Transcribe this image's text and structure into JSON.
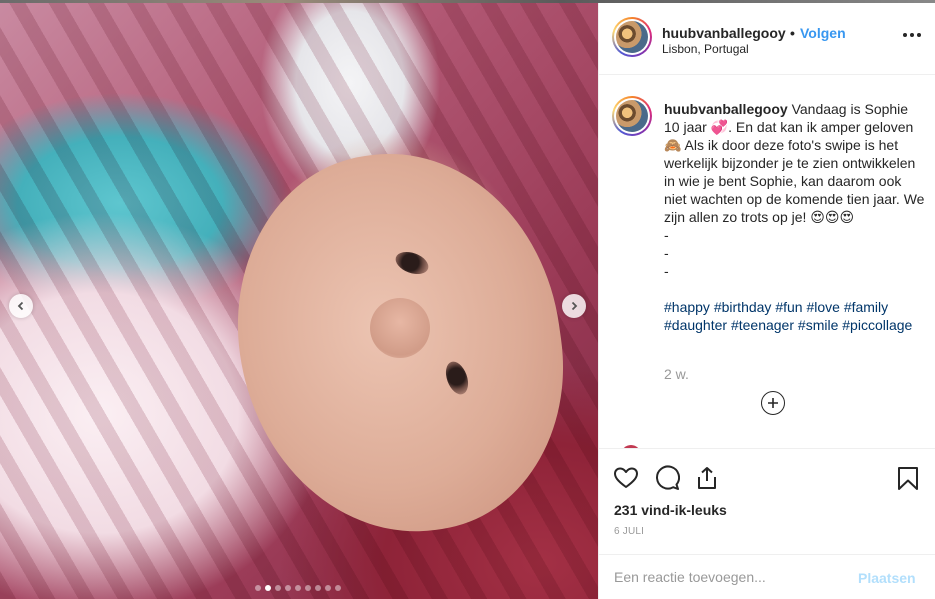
{
  "post": {
    "username": "huubvanballegooy",
    "follow_separator": "•",
    "follow_label": "Volgen",
    "location": "Lisbon, Portugal",
    "caption_text": "Vandaag is Sophie 10 jaar 💞. En dat kan ik amper geloven 🙈 Als ik door deze foto's swipe is het werkelijk bijzonder je te zien ontwikkelen in wie je bent Sophie, kan daarom ook niet wachten op de komende tien jaar. We zijn allen zo trots op je! 😍😍😍\n-\n-\n-",
    "hashtags": [
      "#happy",
      "#birthday",
      "#fun",
      "#love",
      "#family",
      "#daughter",
      "#teenager",
      "#smile",
      "#piccollage"
    ],
    "age": "2 w.",
    "likes": "231 vind-ik-leuks",
    "date": "6 JULI"
  },
  "carousel": {
    "slide_count": 9,
    "active_index": 1
  },
  "comment_box": {
    "placeholder": "Een reactie toevoegen...",
    "post_label": "Plaatsen"
  },
  "icons": {
    "prev": "chevron-left-icon",
    "next": "chevron-right-icon",
    "more": "more-options-icon",
    "load_more": "plus-circle-icon",
    "like": "heart-icon",
    "comment": "comment-bubble-icon",
    "share": "share-icon",
    "save": "bookmark-icon"
  },
  "colors": {
    "link": "#3897f0",
    "hashtag": "#003569",
    "muted": "#999999",
    "post_disabled": "#b2dffc"
  }
}
